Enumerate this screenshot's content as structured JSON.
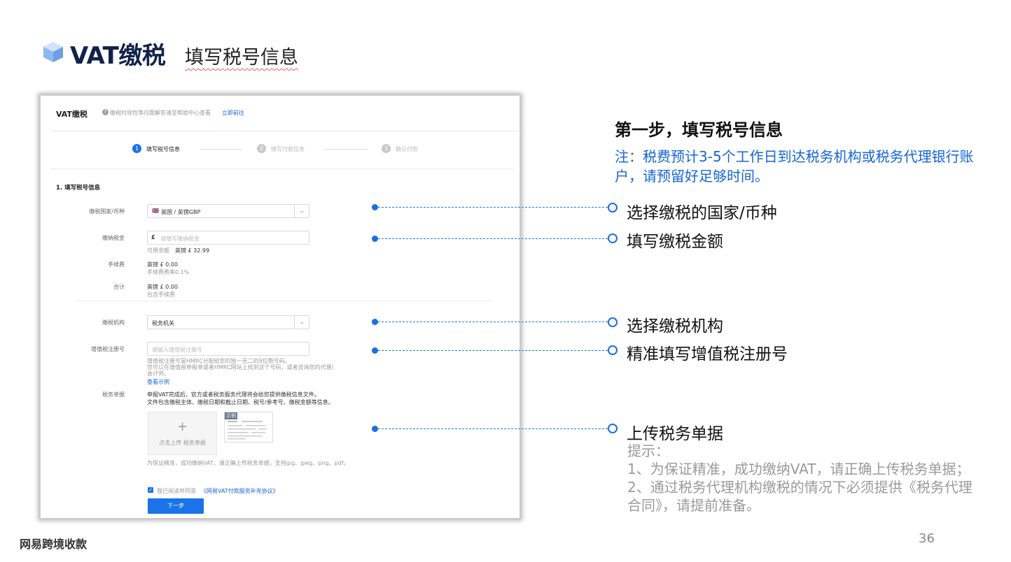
{
  "slide": {
    "title": "VAT缴税",
    "subtitle": "填写税号信息",
    "brand": "网易跨境收款",
    "page_number": "36"
  },
  "panel": {
    "app_title": "VAT缴税",
    "info_text": "缴税时效性等问题解答请至帮助中心查看",
    "info_link": "立即前往",
    "steps": [
      {
        "num": "1",
        "label": "填写税号信息",
        "active": true
      },
      {
        "num": "2",
        "label": "填写付款信息",
        "active": false
      },
      {
        "num": "3",
        "label": "确认付款",
        "active": false
      }
    ],
    "section_title": "1. 填写税号信息",
    "country_label": "缴税国家/币种",
    "country_flag": "🇬🇧",
    "country_value": "英国 / 英镑GBP",
    "amount_label": "缴纳税金",
    "amount_prefix": "£",
    "amount_placeholder": "请填写缴纳税金",
    "available_label": "可用余额",
    "available_value": "英镑 £ 32.99",
    "fee_label": "手续费",
    "fee_value": "英镑 £ 0.00",
    "fee_note": "手续费费率0.1%",
    "total_label": "合计",
    "total_value": "英镑 £ 0.00",
    "total_note": "包含手续费",
    "agency_label": "缴税机构",
    "agency_value": "税务机关",
    "vat_label": "增值税注册号",
    "vat_placeholder": "请输入增值税注册号",
    "vat_help_1": "增值税注册号是HMRC分配给您的独一无二的9位数号码。",
    "vat_help_2": "您可以在增值税申报单或者HMRC网站上找到这个号码，或者咨询您的代理/",
    "vat_help_3": "会计师。",
    "vat_example_link": "查看示例",
    "doc_label": "税务单据",
    "doc_desc_1": "申报VAT完成后，官方或者税务服务代理将会给您提供缴税信息文件。",
    "doc_desc_2": "文件包含缴税主体、缴税日期和截止日期、税号/参考号、缴税金额等信息。",
    "upload_plus": "+",
    "upload_text": "点击上传 税务单据",
    "sample_badge": "示例",
    "upload_hint": "为保证精准，成功缴纳VAT，请正确上传税务单据，支持jpg、jpeg、png、pdf。",
    "agree_text": "我已阅读并同意",
    "agree_link": "《网易VAT付款服务补充协议》",
    "next_button": "下一步"
  },
  "right": {
    "step_heading": "第一步，填写税号信息",
    "note": "注：税费预计3-5个工作日到达税务机构或税务代理银行账户，请预留好足够时间。",
    "callouts": {
      "country": "选择缴税的国家/币种",
      "amount": "填写缴税金额",
      "agency": "选择缴税机构",
      "vat": "精准填写增值税注册号",
      "upload": "上传税务单据"
    },
    "tips_title": "提示：",
    "tip_1": "1、为保证精准，成功缴纳VAT，请正确上传税务单据；",
    "tip_2": "2、通过税务代理机构缴税的情况下必须提供《税务代理合同》，请提前准备。"
  },
  "colors": {
    "accent": "#1a73e8",
    "title_navy": "#11224a",
    "note_blue": "#1565d8",
    "tip_gray": "#9a9a9a"
  }
}
